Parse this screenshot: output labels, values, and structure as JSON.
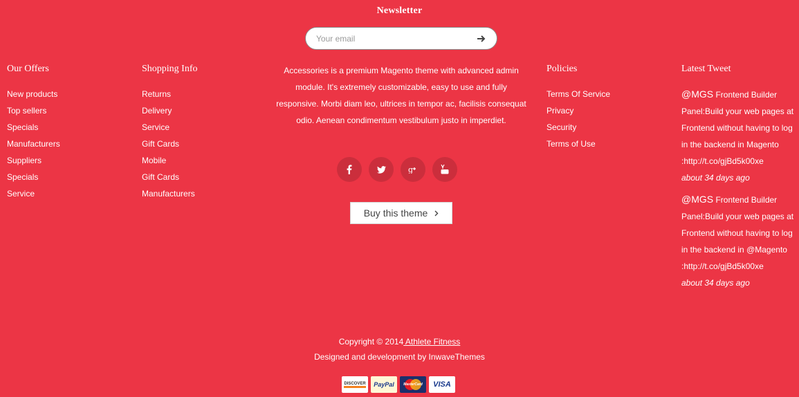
{
  "newsletter": {
    "title": "Newsletter",
    "placeholder": "Your email"
  },
  "columns": {
    "offers": {
      "title": "Our Offers",
      "items": [
        "New products",
        "Top sellers",
        "Specials",
        "Manufacturers",
        "Suppliers",
        "Specials",
        "Service"
      ]
    },
    "shopping": {
      "title": "Shopping Info",
      "items": [
        "Returns",
        "Delivery",
        "Service",
        "Gift Cards",
        "Mobile",
        "Gift Cards",
        "Manufacturers"
      ]
    },
    "about": {
      "text": "Accessories is a premium Magento theme with advanced admin module. It's extremely customizable, easy to use and fully responsive. Morbi diam leo, ultrices in tempor ac, facilisis consequat odio. Aenean condimentum vestibulum justo in imperdiet.",
      "social": [
        "facebook-icon",
        "twitter-icon",
        "google-plus-icon",
        "youtube-icon"
      ],
      "buy_label": "Buy this theme",
      "buy_icon": "chevron-right-icon"
    },
    "policies": {
      "title": "Policies",
      "items": [
        "Terms Of Service",
        "Privacy",
        "Security",
        "Terms of Use"
      ]
    },
    "tweets": {
      "title": "Latest Tweet",
      "items": [
        {
          "handle": "@MGS",
          "text": " Frontend Builder Panel:Build your web pages at Frontend without having to log in the backend in Magento :http://t.co/gjBd5k00xe",
          "time": "about 34 days ago"
        },
        {
          "handle": "@MGS",
          "text": " Frontend Builder Panel:Build your web pages at Frontend without having to log in the backend in @Magento :http://t.co/gjBd5k00xe",
          "time": "about 34 days ago"
        }
      ]
    }
  },
  "footer": {
    "copyright_prefix": "Copyright © 2014",
    "copyright_link": " Athlete Fitness",
    "credits": "Designed and development by InwaveThemes",
    "payments": [
      "DISCOVER",
      "PayPal",
      "MasterCard",
      "VISA"
    ]
  },
  "colors": {
    "background": "#ec3545",
    "text": "#ffffff"
  }
}
